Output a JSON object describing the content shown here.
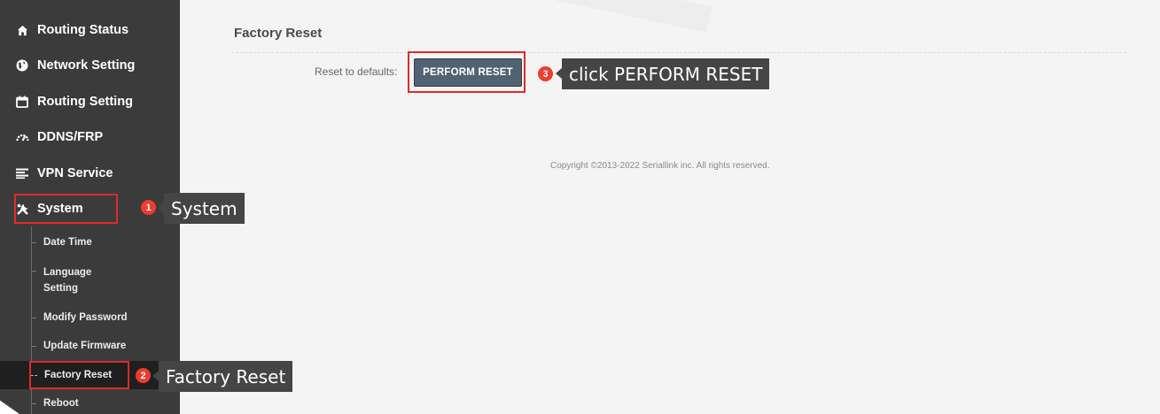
{
  "sidebar": {
    "items": [
      {
        "label": "Routing Status",
        "icon": "home-icon"
      },
      {
        "label": "Network Setting",
        "icon": "globe-icon"
      },
      {
        "label": "Routing Setting",
        "icon": "calendar-icon"
      },
      {
        "label": "DDNS/FRP",
        "icon": "gauge-icon"
      },
      {
        "label": "VPN Service",
        "icon": "list-icon"
      },
      {
        "label": "System",
        "icon": "tools-icon"
      }
    ],
    "system_sub": [
      {
        "label": "Date Time"
      },
      {
        "label": "Language Setting"
      },
      {
        "label": "Modify Password"
      },
      {
        "label": "Update Firmware"
      },
      {
        "label": "Factory Reset",
        "active": true
      },
      {
        "label": "Reboot"
      }
    ]
  },
  "main": {
    "title": "Factory Reset",
    "reset_label": "Reset to defaults:",
    "reset_button": "PERFORM RESET",
    "copyright": "Copyright ©2013-2022 Seriallink inc. All rights reserved."
  },
  "annotations": {
    "step1": {
      "number": "1",
      "text": "System"
    },
    "step2": {
      "number": "2",
      "text": "Factory Reset"
    },
    "step3": {
      "number": "3",
      "text": "click PERFORM RESET"
    },
    "color": "#e02a2a"
  }
}
